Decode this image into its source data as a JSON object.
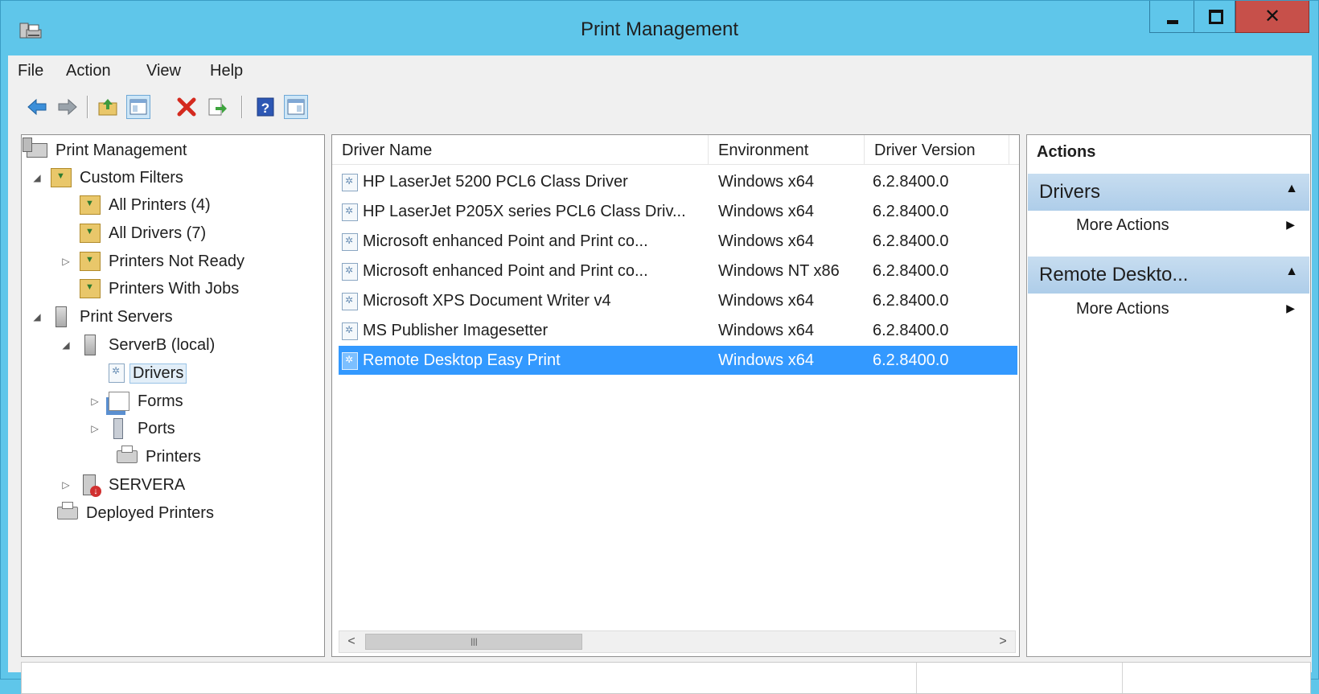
{
  "window": {
    "title": "Print Management"
  },
  "menu": [
    "File",
    "Action",
    "View",
    "Help"
  ],
  "toolbar": {
    "icons": [
      "back-arrow-icon",
      "forward-arrow-icon",
      "up-folder-icon",
      "show-hide-tree-icon",
      "delete-icon",
      "export-icon",
      "help-icon",
      "show-hide-action-pane-icon"
    ]
  },
  "tree": {
    "root": "Print Management",
    "custom_filters": "Custom Filters",
    "all_printers": "All Printers (4)",
    "all_drivers": "All Drivers (7)",
    "printers_not_ready": "Printers Not Ready",
    "printers_with_jobs": "Printers With Jobs",
    "print_servers": "Print Servers",
    "serverb": "ServerB (local)",
    "drivers": "Drivers",
    "forms": "Forms",
    "ports": "Ports",
    "printers": "Printers",
    "servera": "SERVERA",
    "deployed_printers": "Deployed Printers"
  },
  "list": {
    "columns": [
      "Driver Name",
      "Environment",
      "Driver Version"
    ],
    "rows": [
      {
        "name": "HP LaserJet 5200 PCL6 Class Driver",
        "environment": "Windows x64",
        "version": "6.2.8400.0"
      },
      {
        "name": "HP LaserJet P205X series PCL6 Class Driv...",
        "environment": "Windows x64",
        "version": "6.2.8400.0"
      },
      {
        "name": "Microsoft enhanced Point and Print co...",
        "environment": "Windows x64",
        "version": "6.2.8400.0"
      },
      {
        "name": "Microsoft enhanced Point and Print co...",
        "environment": "Windows NT x86",
        "version": "6.2.8400.0"
      },
      {
        "name": "Microsoft XPS Document Writer v4",
        "environment": "Windows x64",
        "version": "6.2.8400.0"
      },
      {
        "name": "MS Publisher Imagesetter",
        "environment": "Windows x64",
        "version": "6.2.8400.0"
      },
      {
        "name": "Remote Desktop Easy Print",
        "environment": "Windows x64",
        "version": "6.2.8400.0"
      }
    ],
    "selected_index": 6
  },
  "actions": {
    "title": "Actions",
    "sections": [
      {
        "label": "Drivers",
        "item": "More Actions"
      },
      {
        "label": "Remote Deskto...",
        "item": "More Actions"
      }
    ]
  },
  "scrollbar": {
    "left": "<",
    "right": ">",
    "grip": "III"
  },
  "colors": {
    "titlebar": "#5fc6ea",
    "selection": "#3399ff",
    "close_button": "#c7504a",
    "action_section": "#b9d5ec"
  }
}
